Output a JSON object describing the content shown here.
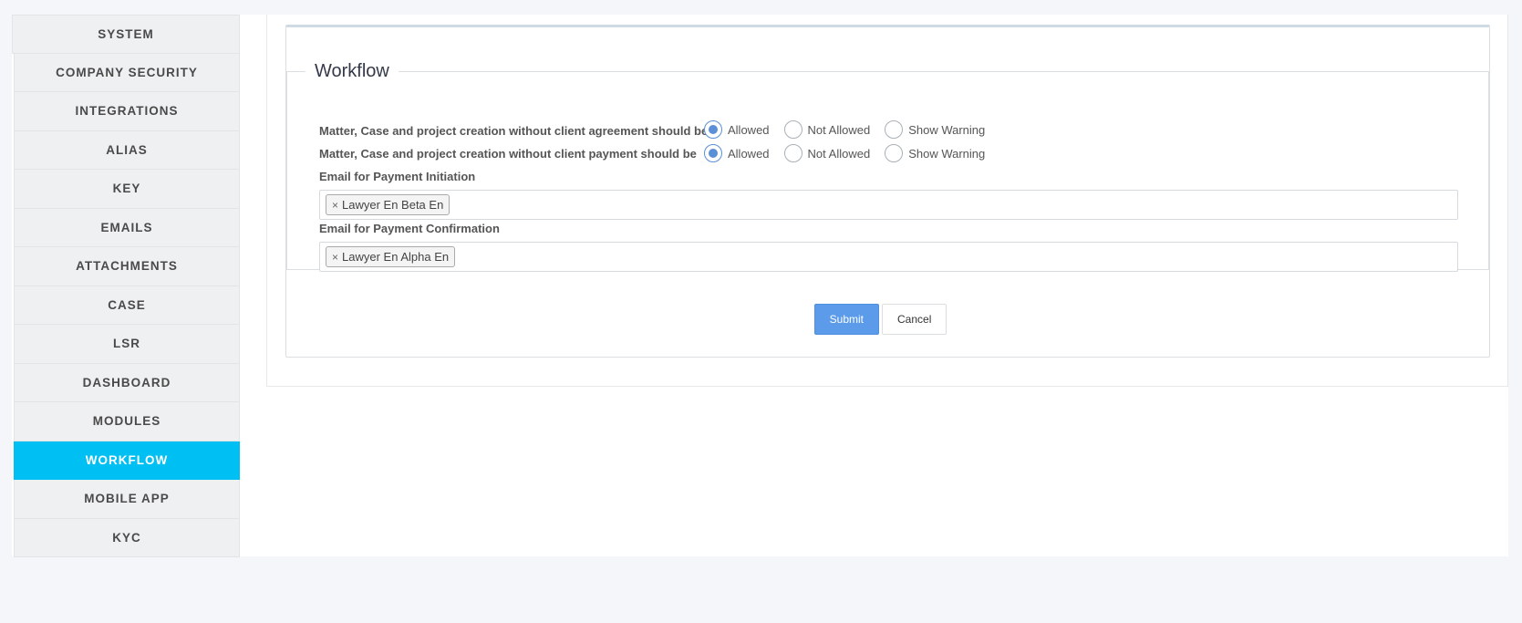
{
  "sidebar": {
    "items": [
      {
        "label": "SYSTEM",
        "active": false
      },
      {
        "label": "COMPANY SECURITY",
        "active": false
      },
      {
        "label": "INTEGRATIONS",
        "active": false
      },
      {
        "label": "ALIAS",
        "active": false
      },
      {
        "label": "KEY",
        "active": false
      },
      {
        "label": "EMAILS",
        "active": false
      },
      {
        "label": "ATTACHMENTS",
        "active": false
      },
      {
        "label": "CASE",
        "active": false
      },
      {
        "label": "LSR",
        "active": false
      },
      {
        "label": "DASHBOARD",
        "active": false
      },
      {
        "label": "MODULES",
        "active": false
      },
      {
        "label": "WORKFLOW",
        "active": true
      },
      {
        "label": "MOBILE APP",
        "active": false
      },
      {
        "label": "KYC",
        "active": false
      }
    ],
    "active_color": "#00bff3"
  },
  "form": {
    "legend": "Workflow",
    "agreement": {
      "label": "Matter, Case and project creation without client agreement should be",
      "options": [
        "Allowed",
        "Not Allowed",
        "Show Warning"
      ],
      "selected": "Allowed"
    },
    "payment": {
      "label": "Matter, Case and project creation without client payment should be",
      "options": [
        "Allowed",
        "Not Allowed",
        "Show Warning"
      ],
      "selected": "Allowed"
    },
    "payment_initiation": {
      "label": "Email for Payment Initiation",
      "tags": [
        "Lawyer En Beta En"
      ]
    },
    "payment_confirmation": {
      "label": "Email for Payment Confirmation",
      "tags": [
        "Lawyer En Alpha En"
      ]
    },
    "remove_symbol": "×"
  },
  "actions": {
    "submit_label": "Submit",
    "cancel_label": "Cancel",
    "submit_color": "#5b9bea"
  }
}
